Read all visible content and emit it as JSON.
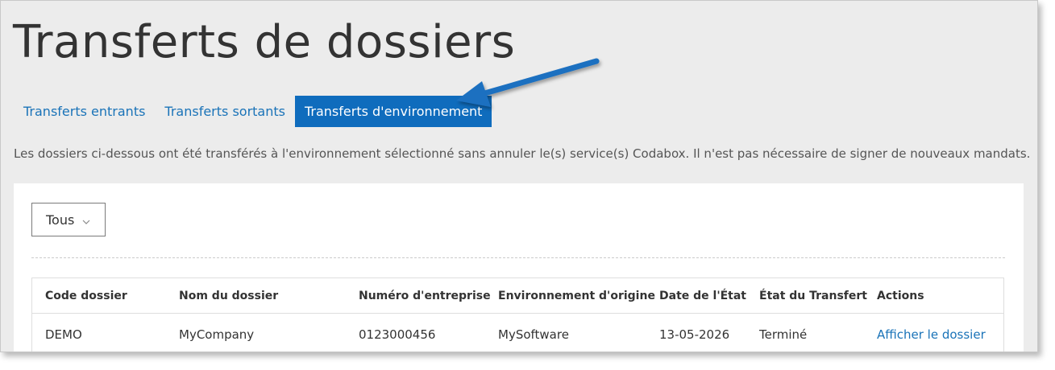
{
  "page": {
    "title": "Transferts de dossiers",
    "description": "Les dossiers ci-dessous ont été transférés à l'environnement sélectionné sans annuler le(s) service(s) Codabox. Il n'est pas nécessaire de signer de nouveaux mandats."
  },
  "tabs": [
    {
      "label": "Transferts entrants",
      "active": false
    },
    {
      "label": "Transferts sortants",
      "active": false
    },
    {
      "label": "Transferts d'environnement",
      "active": true
    }
  ],
  "filter": {
    "selected": "Tous",
    "icon": "chevron-down-icon"
  },
  "table": {
    "headers": [
      "Code dossier",
      "Nom du dossier",
      "Numéro d'entreprise",
      "Environnement d'origine",
      "Date de l'État",
      "État du Transfert",
      "Actions"
    ],
    "rows": [
      [
        "DEMO",
        "MyCompany",
        "0123000456",
        "MySoftware",
        "13-05-2026",
        "Terminé",
        "Afficher le dossier"
      ]
    ]
  },
  "annotation": {
    "icon": "pointer-arrow-icon",
    "color": "#1a6fc0"
  },
  "colors": {
    "accent": "#0f6cbd",
    "link": "#1a73b8"
  }
}
